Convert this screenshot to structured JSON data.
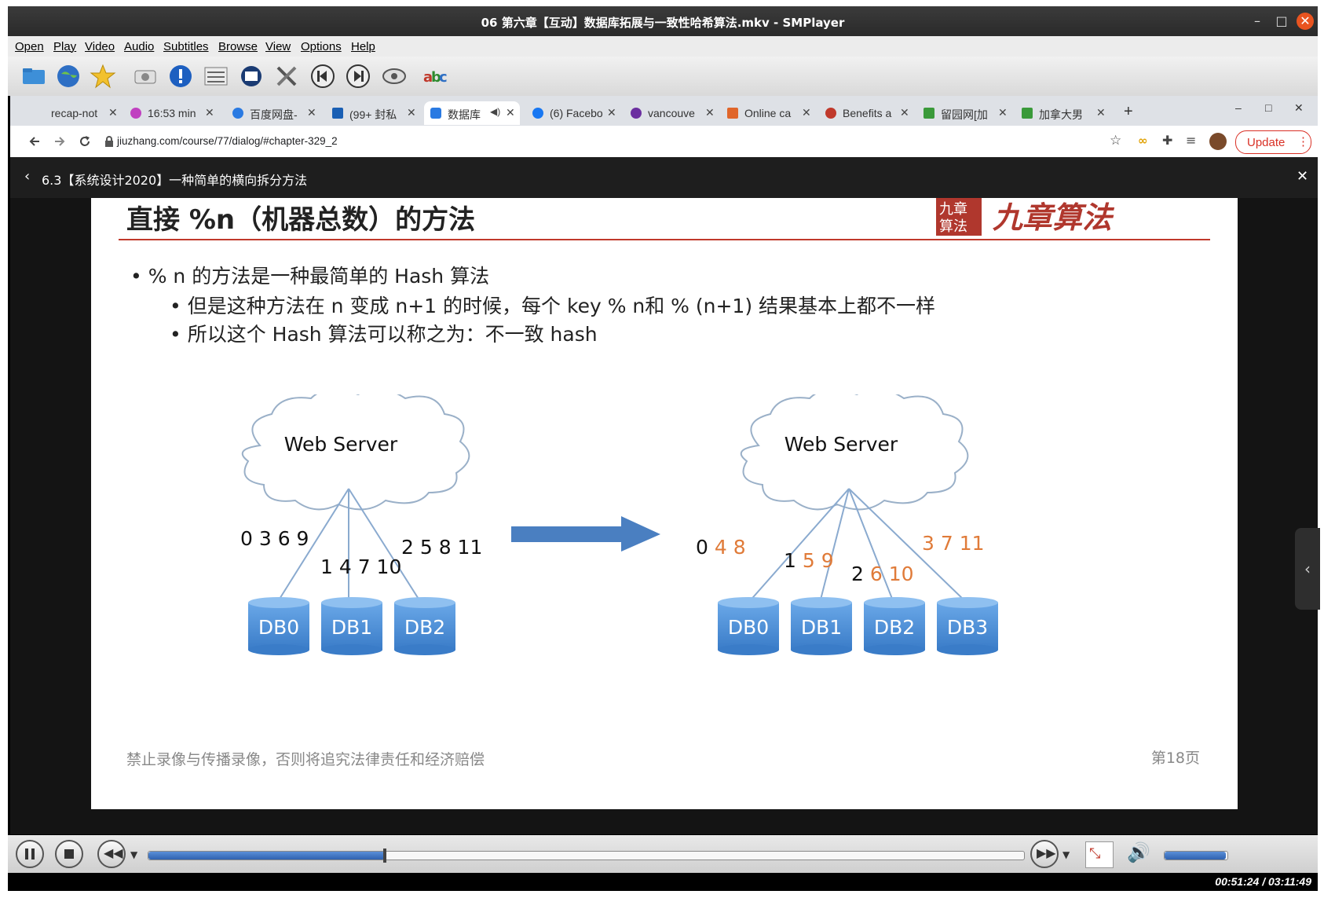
{
  "window": {
    "title": "06 第六章【互动】数据库拓展与一致性哈希算法.mkv - SMPlayer",
    "minimize": "–",
    "maximize": "□",
    "close": "✕"
  },
  "menu": [
    "Open",
    "Play",
    "Video",
    "Audio",
    "Subtitles",
    "Browse",
    "View",
    "Options",
    "Help"
  ],
  "toolbar_icons": [
    "folder-icon",
    "globe-icon",
    "star-icon",
    "screenshot-icon",
    "info-icon",
    "playlist-icon",
    "video-config-icon",
    "tools-icon",
    "previous-icon",
    "next-icon",
    "eye-icon",
    "subtitles-abc-icon"
  ],
  "browser": {
    "tabs": [
      {
        "label": "recap-not",
        "icon_color": ""
      },
      {
        "label": "16:53 min",
        "icon_color": "#c040c0"
      },
      {
        "label": "百度网盘-",
        "icon_color": "#2a7ae2"
      },
      {
        "label": "(99+ 封私",
        "icon_color": "#1a5fb4"
      },
      {
        "label": "数据库",
        "icon_color": "#2a7ae2",
        "active": true
      },
      {
        "label": "(6) Facebo",
        "icon_color": "#1877f2"
      },
      {
        "label": "vancouve",
        "icon_color": "#6b2fa0"
      },
      {
        "label": "Online ca",
        "icon_color": "#e0662a"
      },
      {
        "label": "Benefits a",
        "icon_color": "#c0392b"
      },
      {
        "label": "留园网[加",
        "icon_color": "#3a9a3a"
      },
      {
        "label": "加拿大男",
        "icon_color": "#3a9a3a"
      }
    ],
    "new_tab": "+",
    "url": "jiuzhang.com/course/77/dialog/#chapter-329_2",
    "update_label": "Update",
    "dialog_title": "6.3【系统设计2020】一种简单的横向拆分方法",
    "dialog_close": "✕"
  },
  "slide": {
    "title": "直接 %n（机器总数）的方法",
    "logo_text": "九章算法",
    "bullets": [
      "% n 的方法是一种最简单的 Hash 算法",
      "但是这种方法在 n 变成 n+1 的时候，每个 key % n和 % (n+1) 结果基本上都不一样",
      "所以这个 Hash 算法可以称之为：不一致 hash"
    ],
    "left_diagram": {
      "server": "Web Server",
      "dbs": [
        "DB0",
        "DB1",
        "DB2"
      ],
      "keys": [
        "0 3 6 9",
        "1 4 7 10",
        "2 5 8 11"
      ]
    },
    "right_diagram": {
      "server": "Web Server",
      "dbs": [
        "DB0",
        "DB1",
        "DB2",
        "DB3"
      ],
      "keys": [
        {
          "black": "0",
          "orange": " 4 8"
        },
        {
          "black": "1",
          "orange": " 5 9"
        },
        {
          "black": "2",
          "orange": " 6 10"
        },
        {
          "black": "",
          "orange": "3 7 11"
        }
      ]
    },
    "footer": "禁止录像与传播录像，否则将追究法律责任和经济赔偿",
    "page": "第18页",
    "colors": {
      "accent": "#c0392b",
      "db": "#4a8dd6",
      "orange": "#e07b39",
      "arrow": "#4a7fc1"
    }
  },
  "player": {
    "progress_fraction": 0.27,
    "time": "00:51:24 / 03:11:49",
    "volume_fraction": 0.98
  }
}
